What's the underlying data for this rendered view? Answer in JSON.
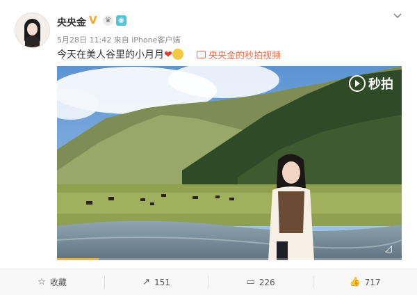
{
  "post": {
    "username": "央央金",
    "verified_badge": "V",
    "timestamp": "5月28日 11:42",
    "source": "来自 iPhone客户端",
    "caption": "今天在美人谷里的小月月",
    "caption_heart": "❤",
    "video_link_label": "央央金的秒拍视频",
    "watermark": "秒拍"
  },
  "video": {
    "progress_fraction": 0.12
  },
  "actions": {
    "favorite_label": "收藏",
    "repost_count": "151",
    "comment_count": "226",
    "like_count": "717"
  },
  "colors": {
    "accent": "#eb7350",
    "badge": "#f5a623",
    "progress": "#f4b13a"
  }
}
